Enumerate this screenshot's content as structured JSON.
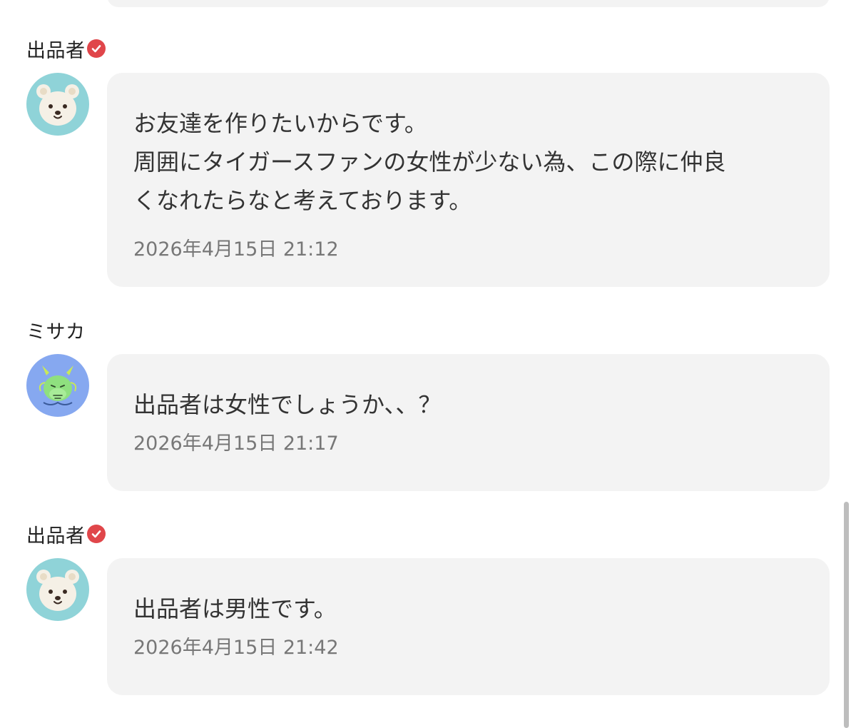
{
  "comments": [
    {
      "author": "出品者",
      "verified": true,
      "avatar": "bear-icon",
      "lines": [
        "お友達を作りたいからです。",
        "周囲にタイガースファンの女性が少ない為、この際に仲良",
        "くなれたらなと考えております。"
      ],
      "timestamp": "2026年4月15日 21:12"
    },
    {
      "author": "ミサカ",
      "verified": false,
      "avatar": "dragon-icon",
      "lines": [
        "出品者は女性でしょうか、、？"
      ],
      "timestamp": "2026年4月15日 21:17"
    },
    {
      "author": "出品者",
      "verified": true,
      "avatar": "bear-icon",
      "lines": [
        "出品者は男性です。"
      ],
      "timestamp": "2026年4月15日 21:42"
    }
  ],
  "colors": {
    "verified_badge": "#e0464a",
    "bear_avatar_bg": "#8fd3d8",
    "dragon_avatar_bg": "#86a8f0",
    "bubble_bg": "#f3f3f3"
  }
}
